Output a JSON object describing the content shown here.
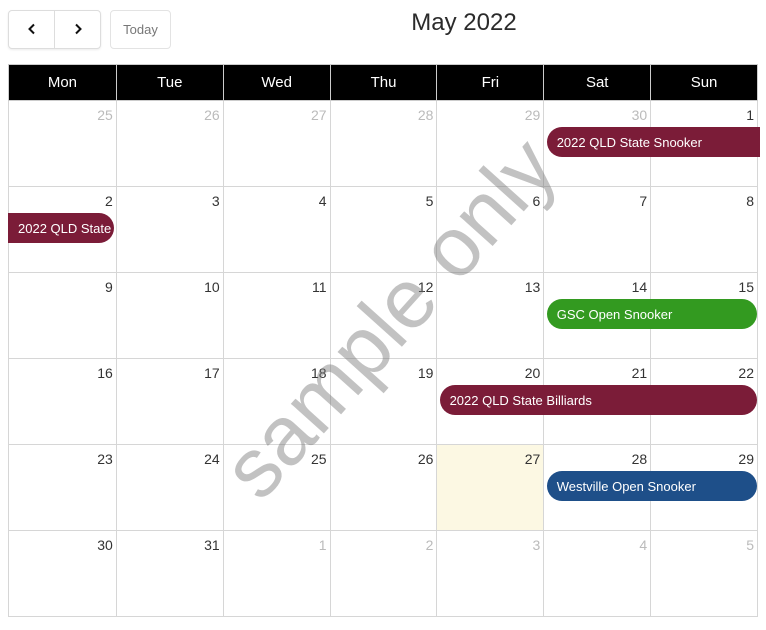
{
  "toolbar": {
    "prev_icon": "chevron-left-icon",
    "next_icon": "chevron-right-icon",
    "today_label": "Today"
  },
  "title": "May 2022",
  "weekdays": [
    "Mon",
    "Tue",
    "Wed",
    "Thu",
    "Fri",
    "Sat",
    "Sun"
  ],
  "weeks": [
    [
      {
        "n": "25",
        "other": true
      },
      {
        "n": "26",
        "other": true
      },
      {
        "n": "27",
        "other": true
      },
      {
        "n": "28",
        "other": true
      },
      {
        "n": "29",
        "other": true
      },
      {
        "n": "30",
        "other": true
      },
      {
        "n": "1"
      }
    ],
    [
      {
        "n": "2"
      },
      {
        "n": "3"
      },
      {
        "n": "4"
      },
      {
        "n": "5"
      },
      {
        "n": "6"
      },
      {
        "n": "7"
      },
      {
        "n": "8"
      }
    ],
    [
      {
        "n": "9"
      },
      {
        "n": "10"
      },
      {
        "n": "11"
      },
      {
        "n": "12"
      },
      {
        "n": "13"
      },
      {
        "n": "14"
      },
      {
        "n": "15"
      }
    ],
    [
      {
        "n": "16"
      },
      {
        "n": "17"
      },
      {
        "n": "18"
      },
      {
        "n": "19"
      },
      {
        "n": "20"
      },
      {
        "n": "21"
      },
      {
        "n": "22"
      }
    ],
    [
      {
        "n": "23"
      },
      {
        "n": "24"
      },
      {
        "n": "25"
      },
      {
        "n": "26"
      },
      {
        "n": "27",
        "today": true
      },
      {
        "n": "28"
      },
      {
        "n": "29"
      }
    ],
    [
      {
        "n": "30"
      },
      {
        "n": "31"
      },
      {
        "n": "1",
        "other": true
      },
      {
        "n": "2",
        "other": true
      },
      {
        "n": "3",
        "other": true
      },
      {
        "n": "4",
        "other": true
      },
      {
        "n": "5",
        "other": true
      }
    ]
  ],
  "events": [
    {
      "title": "2022 QLD State Snooker",
      "week": 0,
      "startCol": 5,
      "endCol": 6,
      "roundStart": true,
      "roundEnd": false,
      "color": "#7b1c38"
    },
    {
      "title": "2022 QLD State",
      "week": 1,
      "startCol": 0,
      "endCol": 0,
      "roundStart": false,
      "roundEnd": true,
      "color": "#7b1c38"
    },
    {
      "title": "GSC Open Snooker",
      "week": 2,
      "startCol": 5,
      "endCol": 6,
      "roundStart": true,
      "roundEnd": true,
      "color": "#339a20"
    },
    {
      "title": "2022 QLD State Billiards",
      "week": 3,
      "startCol": 4,
      "endCol": 6,
      "roundStart": true,
      "roundEnd": true,
      "color": "#7b1c38"
    },
    {
      "title": "Westville Open Snooker",
      "week": 4,
      "startCol": 5,
      "endCol": 6,
      "roundStart": true,
      "roundEnd": true,
      "color": "#1e4f89"
    }
  ],
  "watermark": "sample only"
}
